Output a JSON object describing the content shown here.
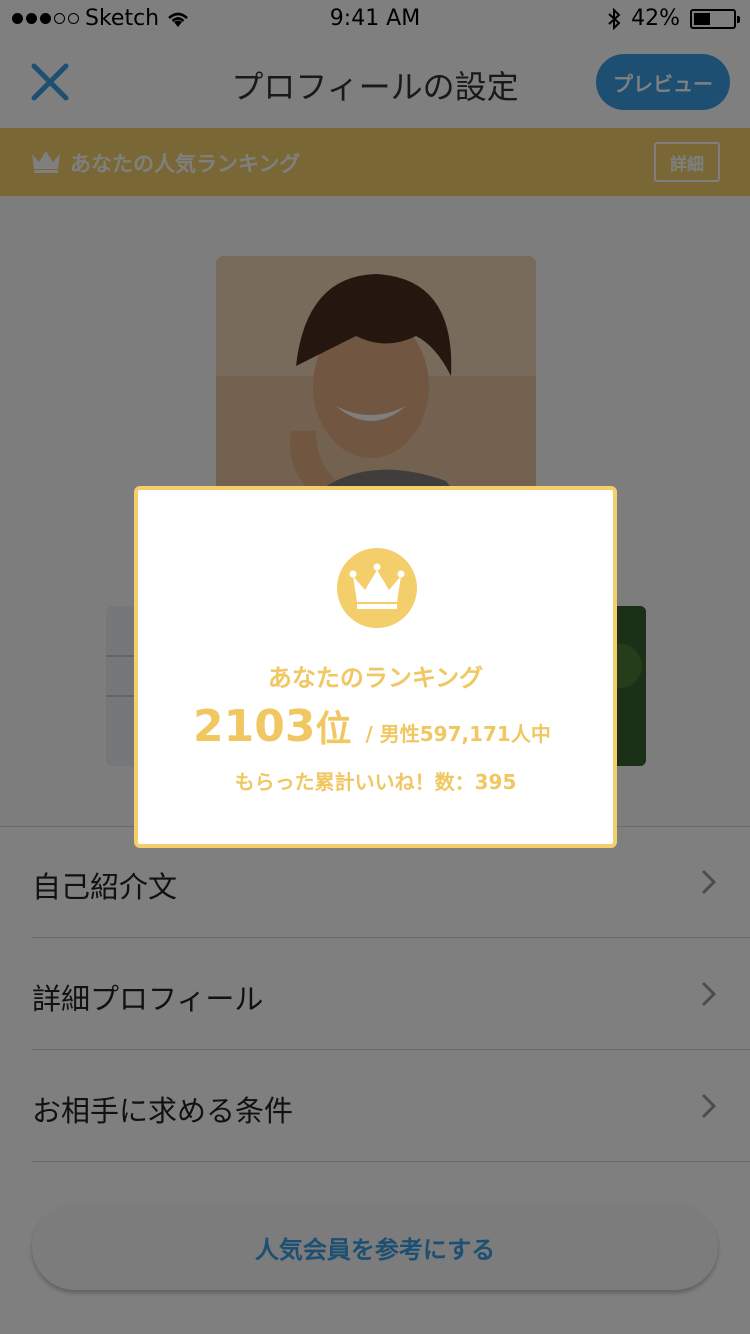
{
  "status_bar": {
    "carrier": "Sketch",
    "time": "9:41 AM",
    "battery_percent": "42%",
    "battery_level": 0.42,
    "icons": [
      "signal-dots-icon",
      "wifi-icon",
      "bluetooth-icon",
      "battery-icon"
    ]
  },
  "nav": {
    "title": "プロフィールの設定",
    "close_icon": "close-icon",
    "preview_label": "プレビュー"
  },
  "ranking_banner": {
    "icon": "crown-icon",
    "label": "あなたの人気ランキング",
    "detail_label": "詳細"
  },
  "menu": {
    "items": [
      {
        "label": "自己紹介文"
      },
      {
        "label": "詳細プロフィール"
      },
      {
        "label": "お相手に求める条件"
      }
    ]
  },
  "popular_button_label": "人気会員を参考にする",
  "modal": {
    "icon": "crown-icon",
    "title": "あなたのランキング",
    "rank": "2103",
    "rank_unit": "位",
    "total": "/ 男性597,171人中",
    "likes": "もらった累計いいね！数：395"
  },
  "colors": {
    "accent_blue": "#3a9ee6",
    "gold": "#f3ce6a",
    "gold_text": "#f0c760",
    "overlay": "rgba(0,0,0,0.5)"
  }
}
